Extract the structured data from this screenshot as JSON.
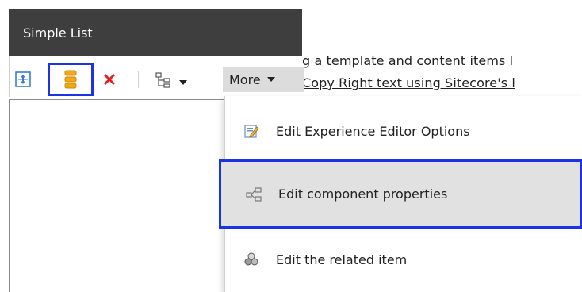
{
  "background_text": {
    "line1": "g a template and content items l",
    "line2": "Copy Right text using Sitecore's l"
  },
  "chrome": {
    "title": "Simple List"
  },
  "toolbar": {
    "buttons": [
      {
        "name": "select-parent",
        "icon": "select-parent-icon"
      },
      {
        "name": "associated-content",
        "icon": "datasource-icon"
      },
      {
        "name": "remove",
        "icon": "red-x-icon"
      },
      {
        "name": "component-tree",
        "icon": "tree-icon"
      }
    ],
    "more_label": "More"
  },
  "menu": {
    "items": [
      {
        "label": "Edit Experience Editor Options",
        "icon": "edit-options-icon"
      },
      {
        "label": "Edit component properties",
        "icon": "component-properties-icon"
      },
      {
        "label": "Edit the related item",
        "icon": "related-item-icon"
      }
    ]
  },
  "colors": {
    "header_bg": "#3e3e3e",
    "highlight_border": "#1a33e6",
    "hover_bg": "#e1e1e1",
    "remove_red": "#e02020",
    "datasource_orange": "#f0a818"
  }
}
